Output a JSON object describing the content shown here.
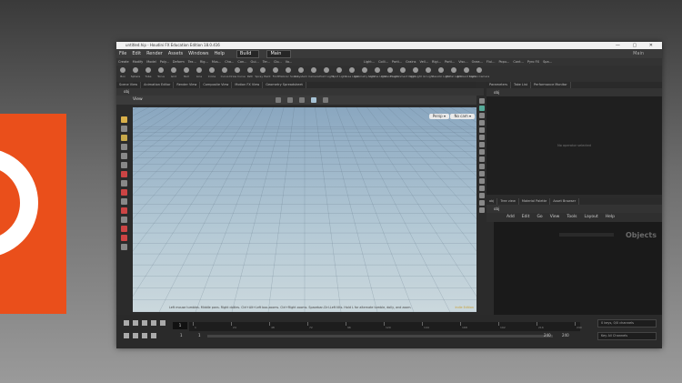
{
  "window": {
    "title": "untitled.hip - Houdini FX Education Edition 18.0.416",
    "controls": "— ▢ ✕"
  },
  "menubar": {
    "items": [
      "File",
      "Edit",
      "Render",
      "Assets",
      "Windows",
      "Help"
    ],
    "desktop": "Build",
    "main_label": "Main",
    "user": "Main"
  },
  "shelf_tabs": [
    "Create",
    "Modify",
    "Model",
    "Poly...",
    "Deform",
    "Tex...",
    "Rig...",
    "Mus...",
    "Cha...",
    "Con...",
    "Gui...",
    "Ter...",
    "Clo...",
    "Vo..."
  ],
  "shelf_tabs_right": [
    "Light...",
    "Colli...",
    "Parti...",
    "Grains",
    "Vell...",
    "Rigi...",
    "Parti...",
    "Visc...",
    "Ocea...",
    "Flui...",
    "Popu...",
    "Cont...",
    "Pyro FX",
    "Spa..."
  ],
  "shelf_tools": [
    "Box",
    "Sphere",
    "Tube",
    "Torus",
    "Grid",
    "Null",
    "Line",
    "Circle",
    "Curve",
    "Draw Curve",
    "Path",
    "Spray Paint",
    "Font",
    "Platonic Solids",
    "L-System",
    "Camera",
    "Point Light",
    "Spot Light",
    "Area Light",
    "Geometry Light",
    "Volume Light",
    "Distant Light",
    "Environment Light",
    "Sky Light",
    "GI Light",
    "Caustic Light",
    "Portal Light",
    "Ambient Light",
    "Stereo Camera"
  ],
  "pane_tabs": [
    "Scene View",
    "Animation Editor",
    "Render View",
    "Composite View",
    "Motion FX View",
    "Geometry Spreadsheet"
  ],
  "obj_path": "obj",
  "viewport": {
    "title": "View",
    "persp": "Persp ▾",
    "cam": "No cam ▾",
    "hint": "Left mouse tumbles. Middle pans. Right dollies. Ctrl+Alt+Left box-zooms. Ctrl+Right zooms. Spacebar-Ctrl-Left tilts. Hold L for alternate tumble, dolly, and zoom.",
    "hint_right": "Indie Edition"
  },
  "params": {
    "tabs": [
      "Parameters",
      "Take List",
      "Performance Monitor"
    ],
    "path": "obj",
    "empty": "No operator selected"
  },
  "network": {
    "tabs": [
      "obj",
      "Tree view",
      "Material Palette",
      "Asset Browser"
    ],
    "path": "obj",
    "menu": [
      "Add",
      "Edit",
      "Go",
      "View",
      "Tools",
      "Layout",
      "Help"
    ],
    "context_label": "Objects"
  },
  "timeline": {
    "frame": "1",
    "start": "1",
    "end": "240",
    "end2": "240",
    "keys_label": "0 keys, 0/0 channels",
    "key_all": "Key All Channels",
    "ticks": [
      "1",
      "24",
      "48",
      "72",
      "96",
      "120",
      "144",
      "168",
      "192",
      "216",
      "240"
    ]
  }
}
